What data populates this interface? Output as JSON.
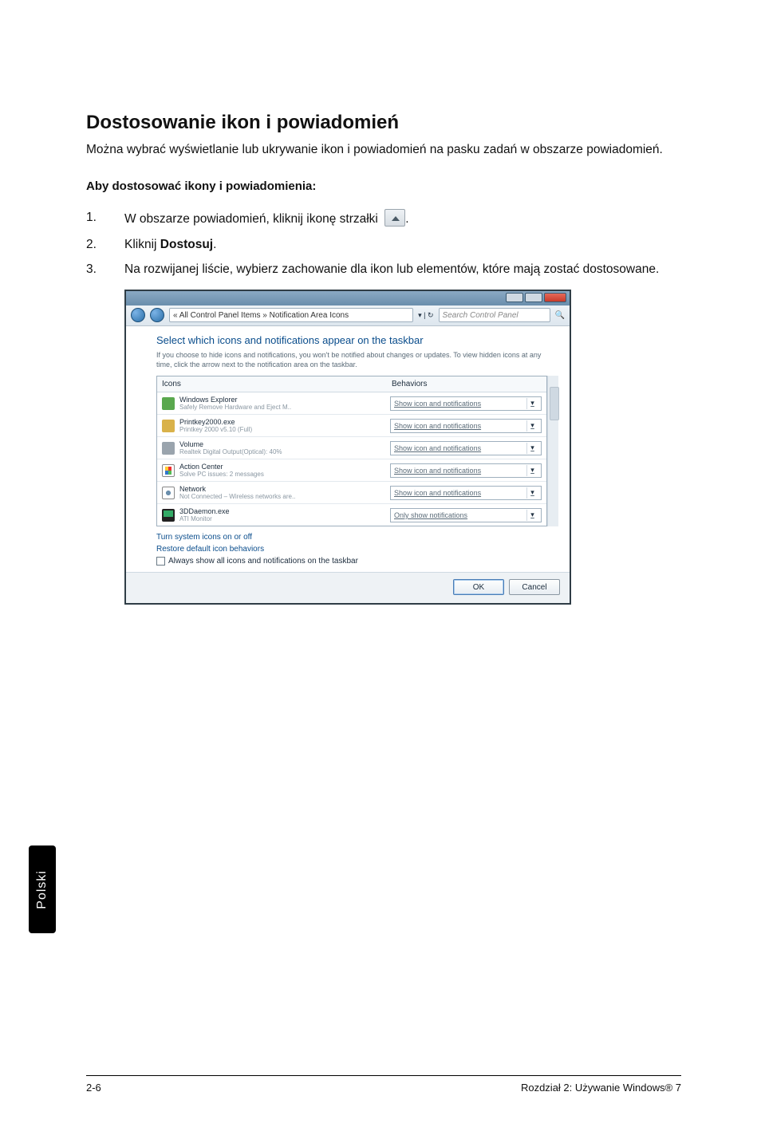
{
  "title": "Dostosowanie ikon i powiadomień",
  "lead": "Można wybrać wyświetlanie lub ukrywanie ikon i powiadomień na pasku zadań w obszarze powiadomień.",
  "subhead": "Aby dostosować ikony i powiadomienia:",
  "steps": [
    {
      "n": "1.",
      "t": "W obszarze powiadomień, kliknij ikonę strzałki",
      "after_icon": "."
    },
    {
      "n": "2.",
      "t_prefix": "Kliknij ",
      "bold": "Dostosuj",
      "t_suffix": "."
    },
    {
      "n": "3.",
      "t": "Na rozwijanej liście, wybierz zachowanie dla ikon lub elementów, które mają zostać dostosowane."
    }
  ],
  "shot": {
    "address": "« All Control Panel Items » Notification Area Icons",
    "search_ph": "Search Control Panel",
    "heading": "Select which icons and notifications appear on the taskbar",
    "hint": "If you choose to hide icons and notifications, you won't be notified about changes or updates. To view hidden icons at any time, click the arrow next to the notification area on the taskbar.",
    "col1": "Icons",
    "col2": "Behaviors",
    "rows": [
      {
        "name": "Windows Explorer",
        "sub": "Safely Remove Hardware and Eject M..",
        "sel": "Show icon and notifications"
      },
      {
        "name": "Printkey2000.exe",
        "sub": "Printkey 2000 v5.10 (Full)",
        "sel": "Show icon and notifications"
      },
      {
        "name": "Volume",
        "sub": "Realtek Digital Output(Optical): 40%",
        "sel": "Show icon and notifications"
      },
      {
        "name": "Action Center",
        "sub": "Solve PC issues: 2 messages",
        "sel": "Show icon and notifications"
      },
      {
        "name": "Network",
        "sub": "Not Connected – Wireless networks are..",
        "sel": "Show icon and notifications"
      },
      {
        "name": "3DDaemon.exe",
        "sub": "ATI Monitor",
        "sel": "Only show notifications"
      }
    ],
    "link1": "Turn system icons on or off",
    "link2": "Restore default icon behaviors",
    "checkbox": "Always show all icons and notifications on the taskbar",
    "ok": "OK",
    "cancel": "Cancel"
  },
  "side_tab": "Polski",
  "footer": {
    "left": "2-6",
    "right": "Rozdział 2: Używanie Windows® 7"
  }
}
